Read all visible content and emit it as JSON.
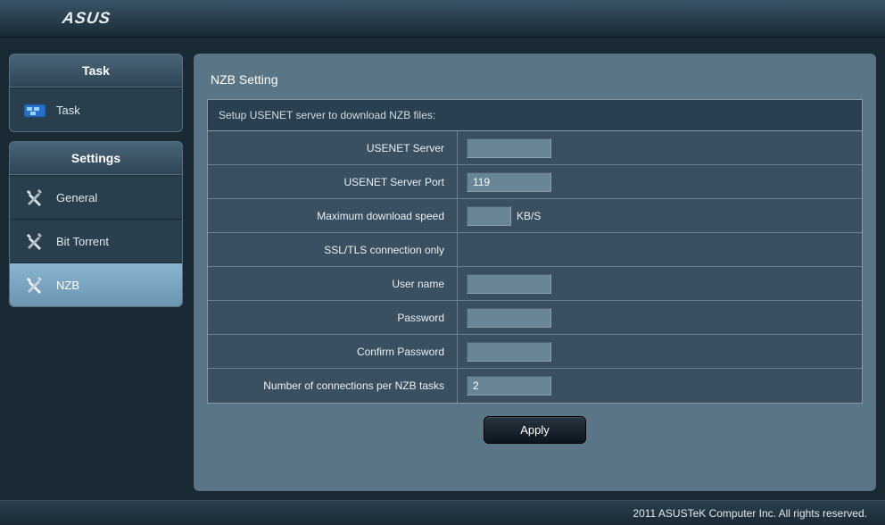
{
  "brand": "ASUS",
  "sidebar": {
    "groups": [
      {
        "header": "Task",
        "items": [
          {
            "label": "Task",
            "icon": "task-icon",
            "active": false
          }
        ]
      },
      {
        "header": "Settings",
        "items": [
          {
            "label": "General",
            "icon": "wrench-icon",
            "active": false
          },
          {
            "label": "Bit Torrent",
            "icon": "wrench-icon",
            "active": false
          },
          {
            "label": "NZB",
            "icon": "wrench-icon",
            "active": true
          }
        ]
      }
    ]
  },
  "panel": {
    "title": "NZB Setting",
    "caption": "Setup USENET server to download NZB files:",
    "fields": {
      "server": {
        "label": "USENET Server",
        "value": ""
      },
      "port": {
        "label": "USENET Server Port",
        "value": "119"
      },
      "speed": {
        "label": "Maximum download speed",
        "value": "",
        "unit": "KB/S"
      },
      "ssl": {
        "label": "SSL/TLS connection only"
      },
      "user": {
        "label": "User name",
        "value": ""
      },
      "pass": {
        "label": "Password",
        "value": ""
      },
      "confirm": {
        "label": "Confirm Password",
        "value": ""
      },
      "conns": {
        "label": "Number of connections per NZB tasks",
        "value": "2"
      }
    },
    "apply": "Apply"
  },
  "footer": "2011 ASUSTeK Computer Inc. All rights reserved."
}
